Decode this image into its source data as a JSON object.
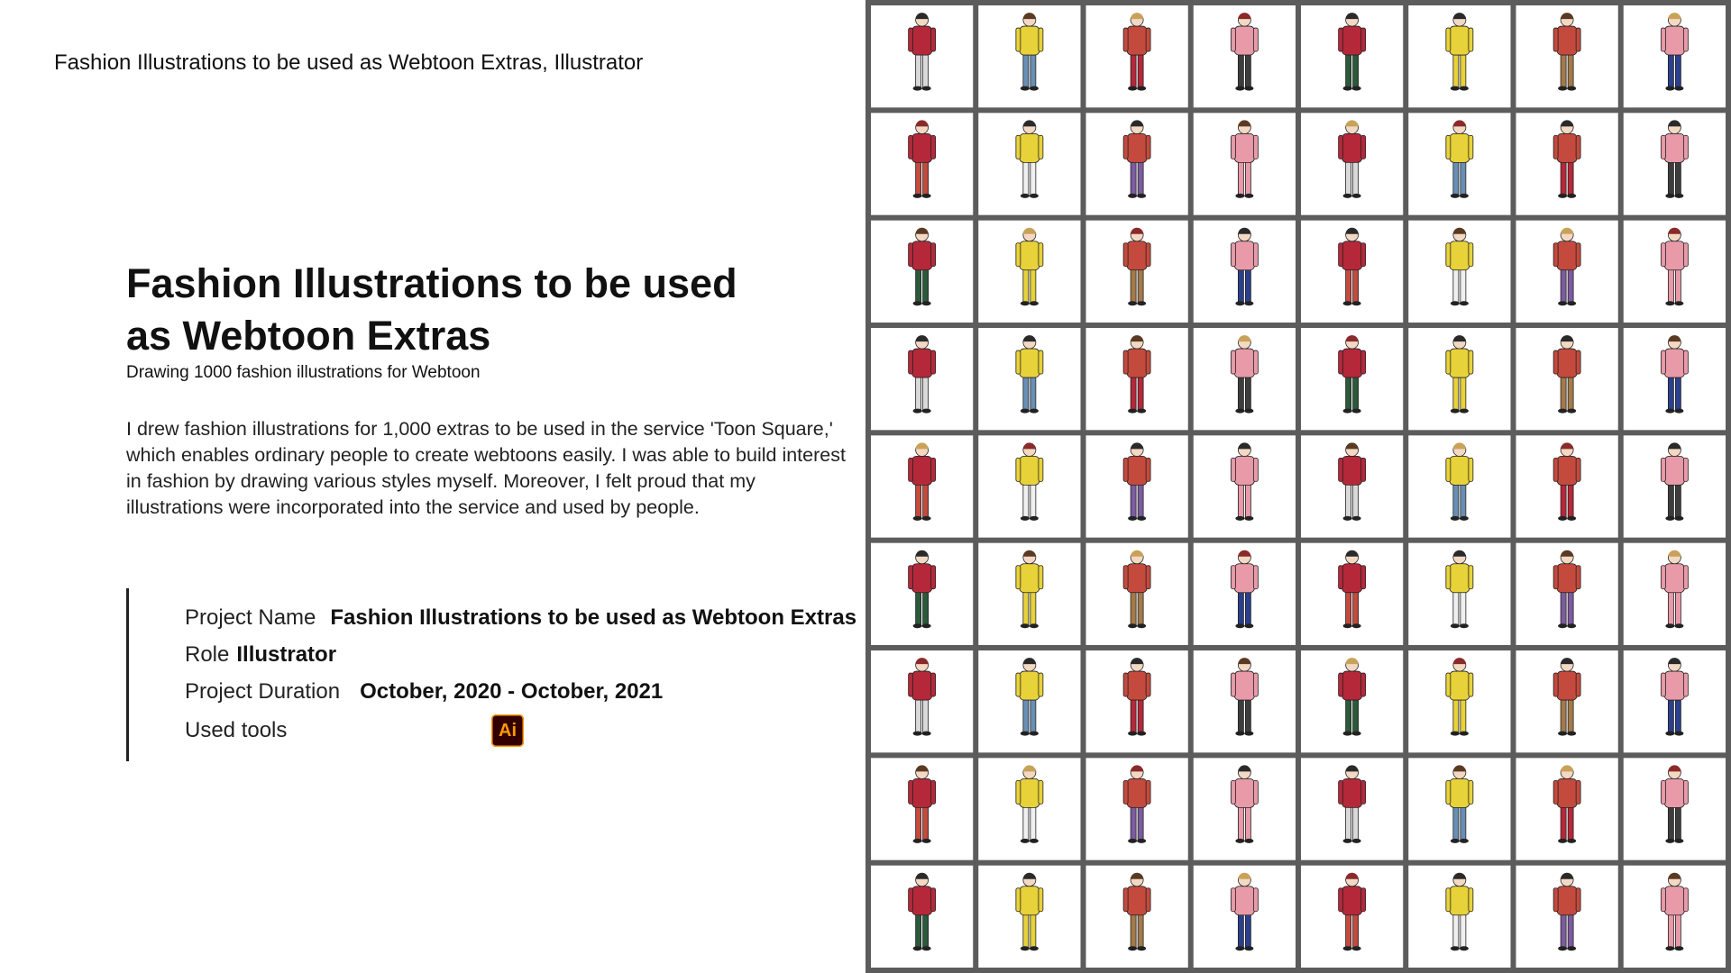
{
  "header": {
    "title": "Fashion Illustrations to be used as Webtoon Extras, Illustrator"
  },
  "project": {
    "title_line1": "Fashion Illustrations to be used",
    "title_line2": "as Webtoon Extras",
    "subtitle": "Drawing 1000 fashion illustrations for Webtoon",
    "description": "I drew fashion illustrations for 1,000 extras to be used in the service 'Toon Square,' which enables ordinary people to create webtoons easily. I was able to build interest in fashion by drawing various styles myself. Moreover, I felt proud that my illustrations were incorporated into the service and used by people."
  },
  "details": {
    "project_name_label": "Project Name",
    "project_name_value": "Fashion Illustrations to be used as Webtoon Extras",
    "role_label": "Role",
    "role_value": "Illustrator",
    "duration_label": "Project Duration",
    "duration_value": "October, 2020 - October, 2021",
    "tools_label": "Used tools",
    "tool_badge": "Ai",
    "tool_icon": "adobe-illustrator-icon"
  },
  "gallery": {
    "rows": 9,
    "cols": 8,
    "palette": [
      "#b5283a",
      "#2b3f8c",
      "#d9d9d9",
      "#e8d23a",
      "#7b5c9e",
      "#3d3d3d",
      "#c44a3d",
      "#6a8fb5",
      "#a47a4a",
      "#e89aa8",
      "#2a5a3a",
      "#f0f0f0"
    ]
  },
  "colors": {
    "gallery_background": "#5c5c5c",
    "tile_background": "#ffffff",
    "ai_badge_bg": "#330000",
    "ai_badge_fg": "#ff9a00"
  }
}
